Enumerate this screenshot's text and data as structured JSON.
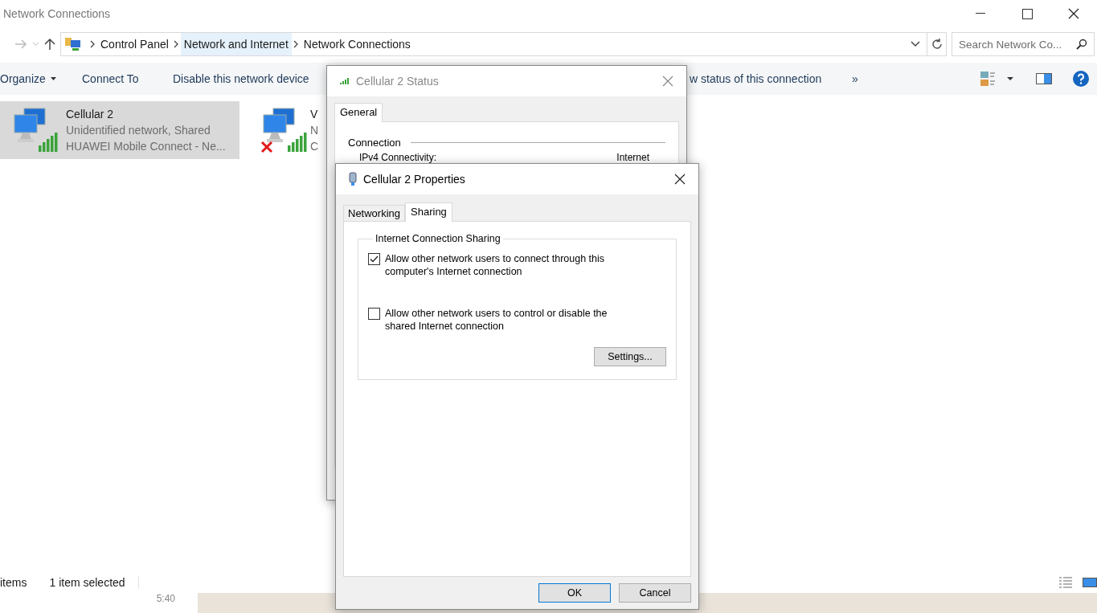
{
  "window": {
    "title": "Network Connections"
  },
  "address": {
    "crumbs": [
      {
        "label": "Control Panel",
        "selected": false
      },
      {
        "label": "Network and Internet",
        "selected": true
      },
      {
        "label": "Network Connections",
        "selected": false
      }
    ]
  },
  "search": {
    "placeholder": "Search Network Co..."
  },
  "commands": [
    "Organize",
    "Connect To",
    "Disable this network device",
    "w status of this connection",
    "»"
  ],
  "connections": [
    {
      "name": "Cellular 2",
      "status": "Unidentified network, Shared",
      "device": "HUAWEI Mobile Connect - Ne...",
      "selected": true,
      "disconnected": false
    },
    {
      "name": "V",
      "status": "N",
      "device": "C",
      "selected": false,
      "disconnected": true
    }
  ],
  "status_bar": {
    "count": "items",
    "selection": "1 item selected"
  },
  "status_dialog": {
    "title": "Cellular 2 Status",
    "tabs": [
      {
        "label": "General",
        "selected": true
      }
    ],
    "section": "Connection",
    "rows": [
      {
        "label": "IPv4 Connectivity:",
        "value": "Internet"
      }
    ]
  },
  "properties_dialog": {
    "title": "Cellular 2 Properties",
    "tabs": [
      {
        "label": "Networking",
        "selected": false
      },
      {
        "label": "Sharing",
        "selected": true
      }
    ],
    "group": "Internet Connection Sharing",
    "options": [
      {
        "label": "Allow other network users to connect through this computer's Internet connection",
        "checked": true
      },
      {
        "label": "Allow other network users to control or disable the shared Internet connection",
        "checked": false
      }
    ],
    "settings_button": "Settings...",
    "buttons": [
      "OK",
      "Cancel"
    ]
  },
  "background": {
    "time": "5:40"
  }
}
